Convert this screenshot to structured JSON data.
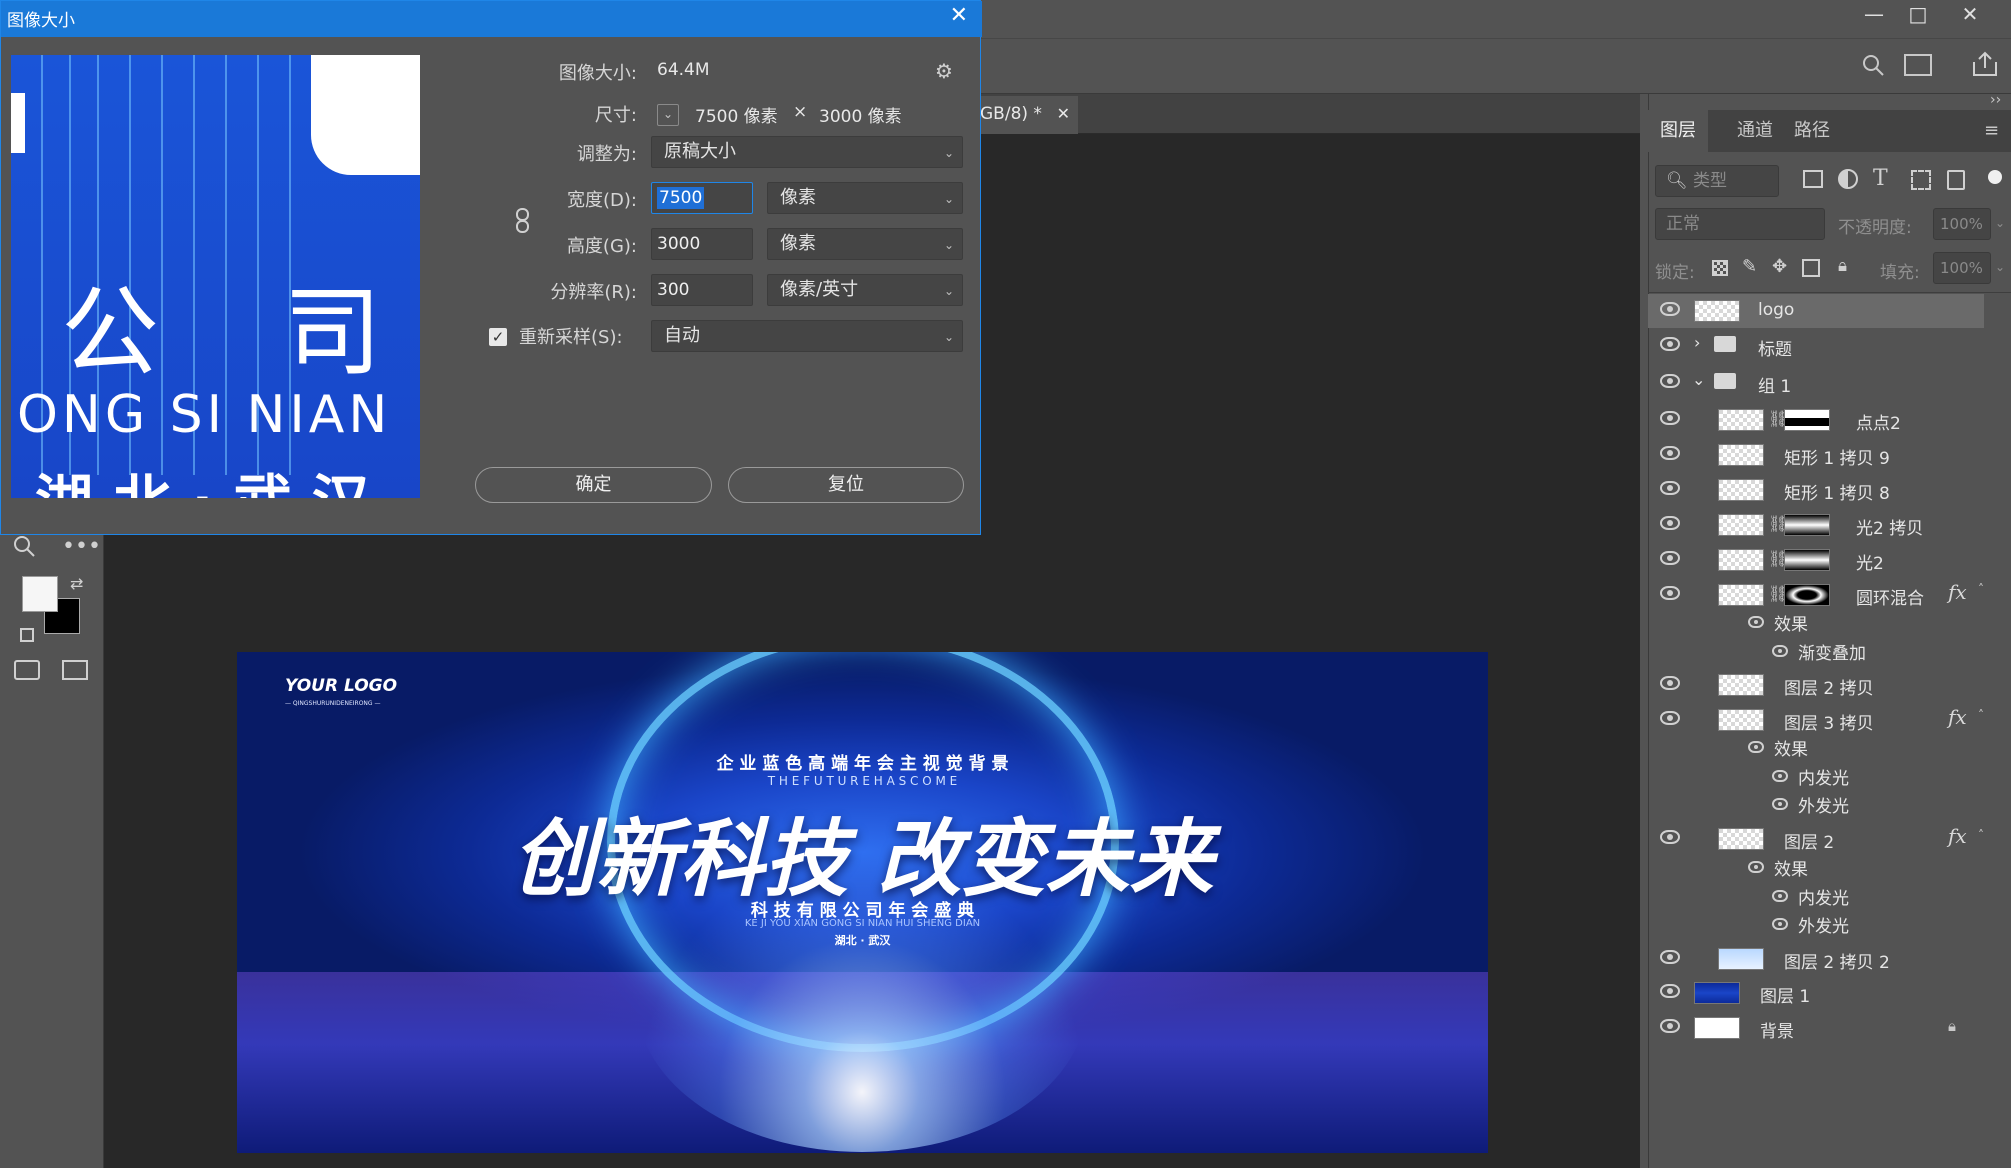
{
  "dialog": {
    "title": "图像大小",
    "image_size_label": "图像大小:",
    "image_size_value": "64.4M",
    "dimensions_label": "尺寸:",
    "dimensions_width": "7500 像素",
    "dimensions_x": "×",
    "dimensions_height": "3000 像素",
    "fit_to_label": "调整为:",
    "fit_to_value": "原稿大小",
    "width_label": "宽度(D):",
    "width_value": "7500",
    "width_unit": "像素",
    "height_label": "高度(G):",
    "height_value": "3000",
    "height_unit": "像素",
    "resolution_label": "分辨率(R):",
    "resolution_value": "300",
    "resolution_unit": "像素/英寸",
    "resample_label": "重新采样(S):",
    "resample_value": "自动",
    "ok_button": "确定",
    "reset_button": "复位",
    "preview": {
      "line1": "公    司",
      "line2": "ONG SI NIAN",
      "line3": "湖 北 · 武 汉"
    }
  },
  "document_tab": {
    "title": "GB/8) *"
  },
  "artwork": {
    "logo": "YOUR LOGO",
    "logo_sub": "— QINGSHURUNIDENEIRONG —",
    "subtitle": "企 业 蓝 色 高 端 年 会 主 视 觉 背 景",
    "tagline": "T H E   F U T U R E   H A S   C O M E",
    "headline": "创新科技 改变未来",
    "company": "科 技 有 限 公 司 年 会 盛 典",
    "pinyin": "KE JI YOU XIAN GONG SI NIAN HUI SHENG DIAN",
    "location": "湖北 · 武汉"
  },
  "panel": {
    "tabs": [
      "图层",
      "通道",
      "路径"
    ],
    "active_tab": 0,
    "filter_placeholder": "类型",
    "blend_mode": "正常",
    "opacity_label": "不透明度:",
    "opacity_value": "100%",
    "lock_label": "锁定:",
    "fill_label": "填充:",
    "fill_value": "100%"
  },
  "layers": [
    {
      "name": "logo",
      "type": "layer",
      "selected": true
    },
    {
      "name": "标题",
      "type": "group",
      "expanded": false
    },
    {
      "name": "组 1",
      "type": "group",
      "expanded": true
    },
    {
      "name": "点点2",
      "type": "masked"
    },
    {
      "name": "矩形 1 拷贝 9",
      "type": "layer"
    },
    {
      "name": "矩形 1 拷贝 8",
      "type": "layer"
    },
    {
      "name": "光2 拷贝",
      "type": "masked"
    },
    {
      "name": "光2",
      "type": "masked"
    },
    {
      "name": "圆环混合",
      "type": "masked",
      "fx": true
    },
    {
      "name": "效果",
      "type": "effect-header"
    },
    {
      "name": "渐变叠加",
      "type": "effect"
    },
    {
      "name": "图层 2 拷贝",
      "type": "layer"
    },
    {
      "name": "图层 3 拷贝",
      "type": "layer",
      "fx": true
    },
    {
      "name": "效果",
      "type": "effect-header"
    },
    {
      "name": "内发光",
      "type": "effect"
    },
    {
      "name": "外发光",
      "type": "effect"
    },
    {
      "name": "图层 2",
      "type": "layer",
      "fx": true
    },
    {
      "name": "效果",
      "type": "effect-header"
    },
    {
      "name": "内发光",
      "type": "effect"
    },
    {
      "name": "外发光",
      "type": "effect"
    },
    {
      "name": "图层 2 拷贝 2",
      "type": "layer"
    },
    {
      "name": "图层 1",
      "type": "layer"
    },
    {
      "name": "背景",
      "type": "layer",
      "locked": true
    }
  ],
  "fx_label": "fx",
  "colors": {
    "dialog_title_bg": "#1a79d8",
    "panel_bg": "#535353",
    "canvas_bg": "#282828",
    "artwork_blue": "#1a45c8"
  }
}
